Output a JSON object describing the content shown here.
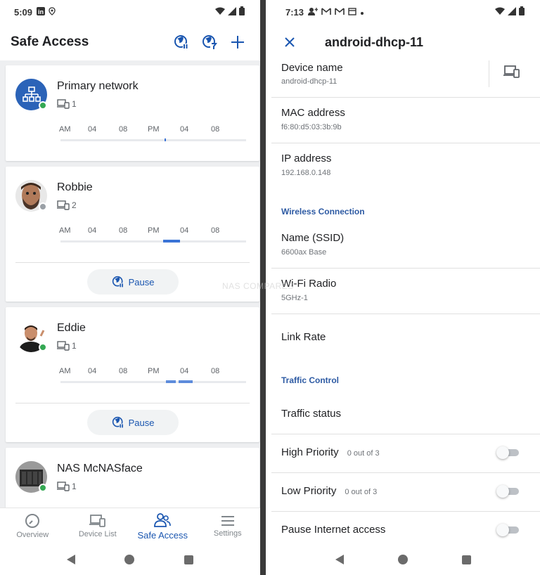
{
  "left": {
    "status": {
      "time": "5:09"
    },
    "appbar": {
      "title": "Safe Access"
    },
    "profiles": [
      {
        "name": "Primary network",
        "devices": "1",
        "status_color": "#34a853",
        "has_pause": false
      },
      {
        "name": "Robbie",
        "devices": "2",
        "status_color": "#9aa0a6",
        "has_pause": true
      },
      {
        "name": "Eddie",
        "devices": "1",
        "status_color": "#34a853",
        "has_pause": true
      },
      {
        "name": "NAS McNASface",
        "devices": "1",
        "status_color": "#34a853",
        "has_pause": false
      }
    ],
    "timeline_labels": [
      "AM",
      "04",
      "08",
      "PM",
      "04",
      "08"
    ],
    "pause_label": "Pause",
    "bottom_nav": [
      {
        "label": "Overview",
        "icon": "gauge-icon"
      },
      {
        "label": "Device List",
        "icon": "devices-icon"
      },
      {
        "label": "Safe Access",
        "icon": "people-icon"
      },
      {
        "label": "Settings",
        "icon": "menu-icon"
      }
    ]
  },
  "right": {
    "status": {
      "time": "7:13"
    },
    "title": "android-dhcp-11",
    "rows": {
      "device_name": {
        "label": "Device name",
        "value": "android-dhcp-11"
      },
      "mac": {
        "label": "MAC address",
        "value": "f6:80:d5:03:3b:9b"
      },
      "ip": {
        "label": "IP address",
        "value": "192.168.0.148"
      },
      "ssid": {
        "label": "Name (SSID)",
        "value": "6600ax Base"
      },
      "radio": {
        "label": "Wi-Fi Radio",
        "value": "5GHz-1"
      },
      "link_rate": {
        "label": "Link Rate"
      },
      "traffic_status": {
        "label": "Traffic status"
      },
      "high_priority": {
        "label": "High Priority",
        "meta": "0 out of 3"
      },
      "low_priority": {
        "label": "Low Priority",
        "meta": "0 out of 3"
      },
      "pause_internet": {
        "label": "Pause Internet access"
      }
    },
    "sections": {
      "wireless": "Wireless Connection",
      "traffic": "Traffic Control"
    },
    "watermark": "NAS COMPARES"
  },
  "colors": {
    "accent": "#1a56b0",
    "section": "#2d5aa3",
    "activity": "#3a73d6",
    "online": "#34a853",
    "offline": "#9aa0a6"
  }
}
